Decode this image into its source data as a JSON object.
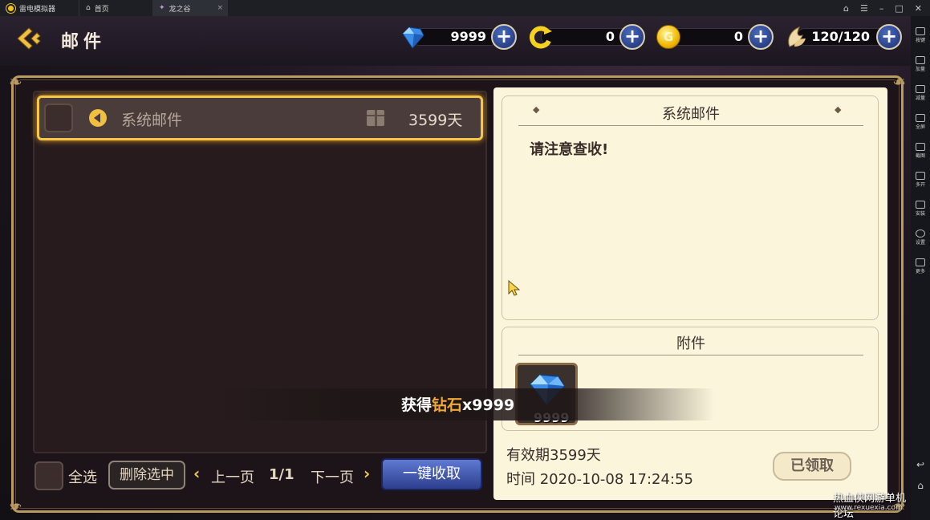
{
  "emulator": {
    "tabs": [
      {
        "label": "雷电模拟器"
      },
      {
        "label": "首页"
      },
      {
        "label": "龙之谷",
        "close": "×"
      }
    ],
    "sidebar": [
      "按键",
      "加量",
      "减量",
      "全屏",
      "截图",
      "多开",
      "安装",
      "设置",
      "更多"
    ]
  },
  "header": {
    "title": "邮件",
    "resources": {
      "diamond": "9999",
      "spin": "0",
      "gold": "0",
      "stamina": "120/120"
    },
    "plus": "+"
  },
  "mail_list": {
    "items": [
      {
        "label": "系统邮件",
        "days": "3599天"
      }
    ]
  },
  "bottom": {
    "select_all": "全选",
    "delete_selected": "删除选中",
    "prev_page": "上一页",
    "page": "1/1",
    "next_page": "下一页",
    "collect_all": "一键收取"
  },
  "detail": {
    "title": "系统邮件",
    "body": "请注意查收!",
    "attachment_title": "附件",
    "attachment_count": "9999",
    "validity": "有效期3599天",
    "time": "时间 2020-10-08 17:24:55",
    "claimed": "已领取"
  },
  "toast": {
    "prefix": "获得",
    "item": "钻石",
    "suffix": "x9999"
  },
  "watermark": {
    "line1": "热血侠网游单机论坛",
    "line2": "www.rexuexia.com"
  },
  "colors": {
    "accent_gold": "#f5c64a",
    "button_blue": "#3d54a8",
    "panel_cream": "#fbf5dc"
  }
}
